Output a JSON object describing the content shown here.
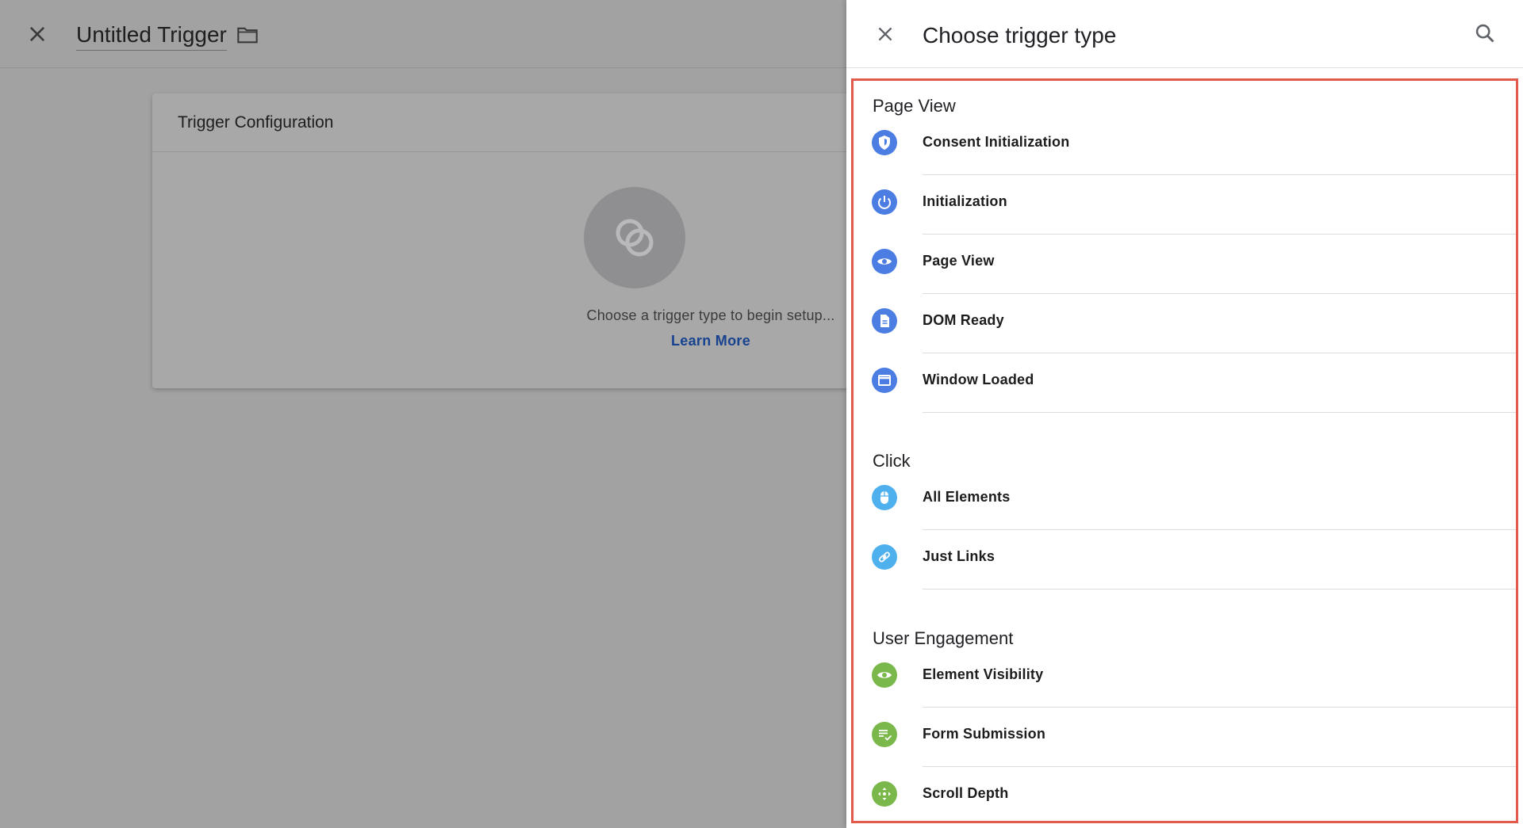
{
  "editor": {
    "title": "Untitled Trigger",
    "config_title": "Trigger Configuration",
    "placeholder_text": "Choose a trigger type to begin setup...",
    "learn_more": "Learn More"
  },
  "drawer": {
    "title": "Choose trigger type",
    "sections": [
      {
        "title": "Page View",
        "items": [
          {
            "label": "Consent Initialization",
            "icon": "shield-icon",
            "color": "#4b7de3"
          },
          {
            "label": "Initialization",
            "icon": "power-icon",
            "color": "#4b7de3"
          },
          {
            "label": "Page View",
            "icon": "eye-icon",
            "color": "#4b7de3"
          },
          {
            "label": "DOM Ready",
            "icon": "document-icon",
            "color": "#4b7de3"
          },
          {
            "label": "Window Loaded",
            "icon": "window-icon",
            "color": "#4b7de3"
          }
        ]
      },
      {
        "title": "Click",
        "items": [
          {
            "label": "All Elements",
            "icon": "mouse-icon",
            "color": "#4fb0ee"
          },
          {
            "label": "Just Links",
            "icon": "link-icon",
            "color": "#4fb0ee"
          }
        ]
      },
      {
        "title": "User Engagement",
        "items": [
          {
            "label": "Element Visibility",
            "icon": "eye-icon",
            "color": "#7ab84c"
          },
          {
            "label": "Form Submission",
            "icon": "form-check-icon",
            "color": "#7ab84c"
          },
          {
            "label": "Scroll Depth",
            "icon": "move-arrows-icon",
            "color": "#7ab84c"
          }
        ]
      }
    ]
  },
  "colors": {
    "highlight_border": "#e35a4d",
    "link": "#17428f"
  }
}
